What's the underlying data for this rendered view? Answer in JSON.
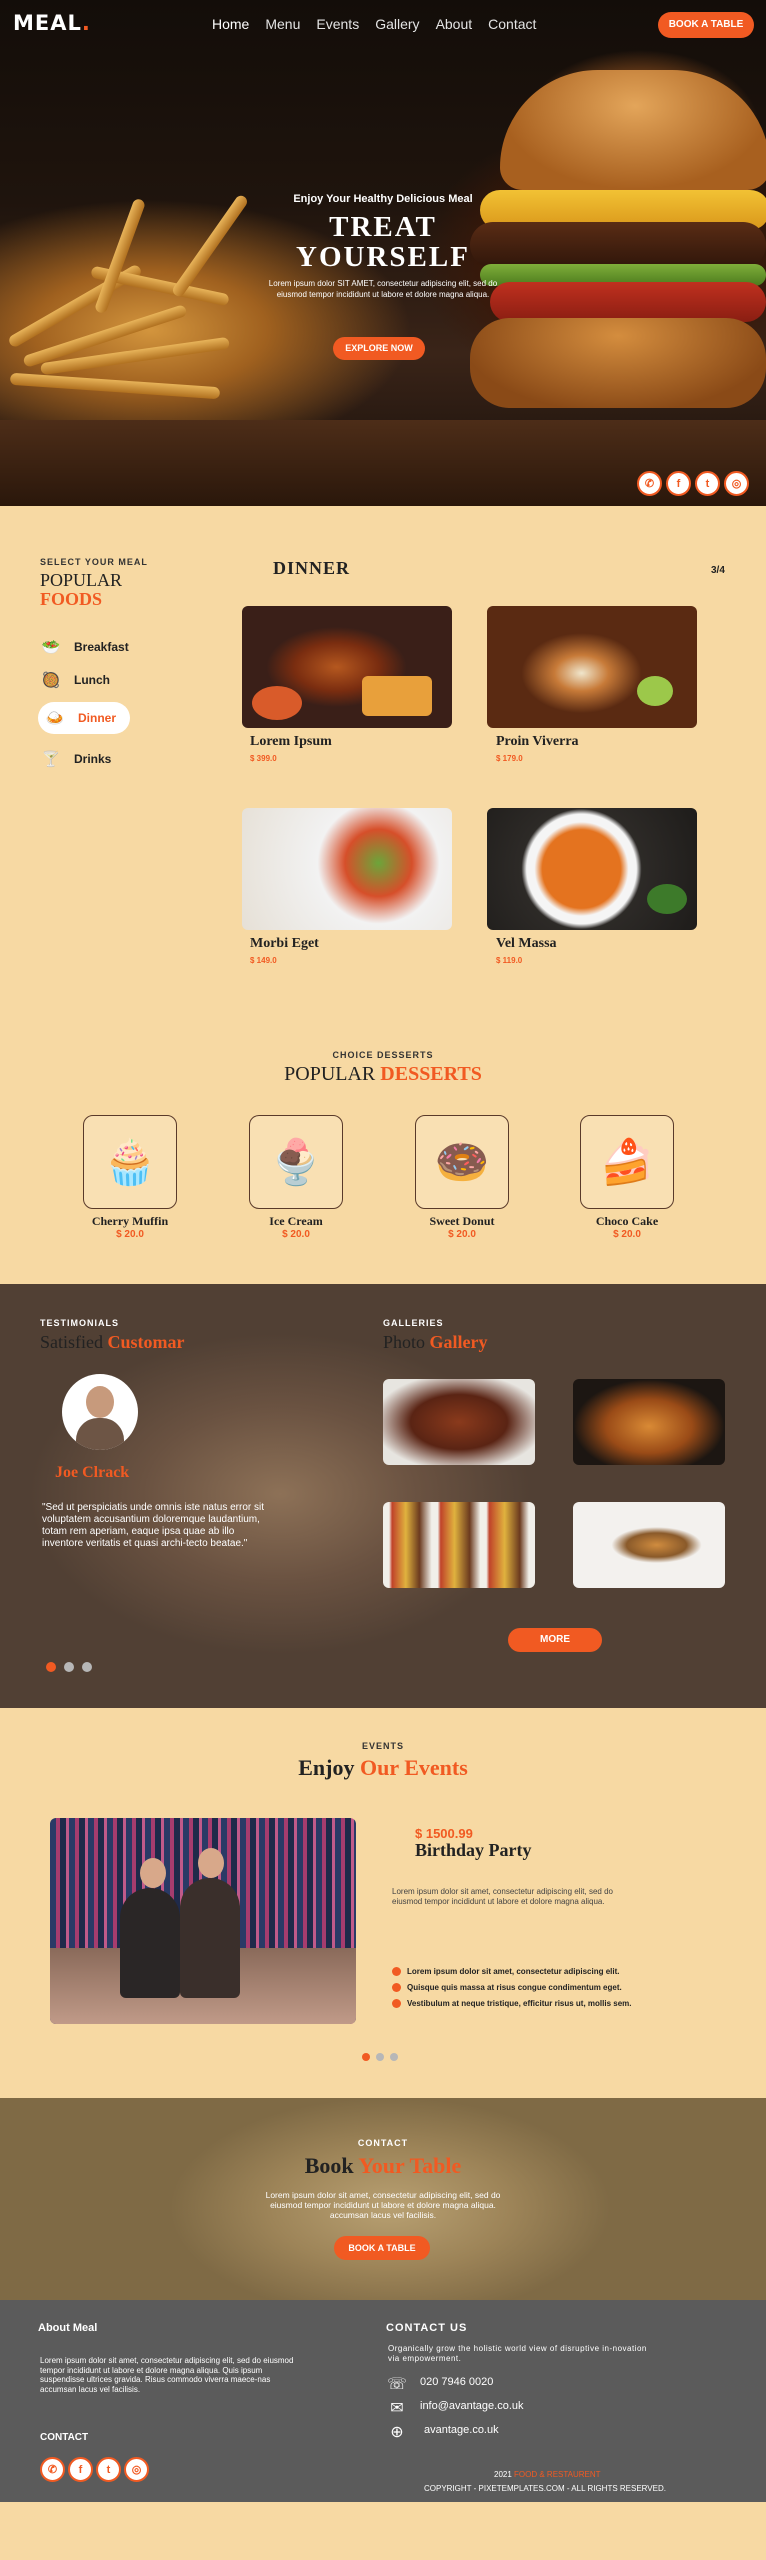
{
  "nav": {
    "logo": "MEAL",
    "links": [
      "Home",
      "Menu",
      "Events",
      "Gallery",
      "About",
      "Contact"
    ],
    "cta": "BOOK A TABLE"
  },
  "hero": {
    "subtitle": "Enjoy Your Healthy Delicious Meal",
    "title_line1": "TREAT",
    "title_line2": "YOURSELF",
    "text": "Lorem ipsum dolor SIT AMET, consectetur adipiscing elit, sed do eiusmod tempor incididunt ut labore et dolore magna aliqua.",
    "button": "EXPLORE NOW",
    "socials": [
      "whatsapp-icon",
      "facebook-icon",
      "twitter-icon",
      "instagram-icon"
    ]
  },
  "foods": {
    "label": "SELECT YOUR MEAL",
    "title1": "POPULAR",
    "title2": "FOODS",
    "categories": [
      "Breakfast",
      "Lunch",
      "Dinner",
      "Drinks"
    ],
    "active": "Dinner",
    "heading": "DINNER",
    "pager": "3/4",
    "items": [
      {
        "name": "Lorem Ipsum",
        "price": "$ 399.0"
      },
      {
        "name": "Proin Viverra",
        "price": "$ 179.0"
      },
      {
        "name": "Morbi Eget",
        "price": "$ 149.0"
      },
      {
        "name": "Vel Massa",
        "price": "$ 119.0"
      }
    ]
  },
  "desserts": {
    "label": "CHOICE DESSERTS",
    "title1": "POPULAR",
    "title2": "DESSERTS",
    "items": [
      {
        "name": "Cherry Muffin",
        "price": "$ 20.0",
        "icon": "cupcake-icon"
      },
      {
        "name": "Ice Cream",
        "price": "$ 20.0",
        "icon": "ice-cream-icon"
      },
      {
        "name": "Sweet Donut",
        "price": "$ 20.0",
        "icon": "donut-icon"
      },
      {
        "name": "Choco Cake",
        "price": "$ 20.0",
        "icon": "cake-icon"
      }
    ]
  },
  "testimonials": {
    "label": "TESTIMONIALS",
    "title1": "Satisfied",
    "title2": "Customar",
    "name": "Joe Clrack",
    "quote": "\"Sed ut perspiciatis unde omnis iste natus error sit voluptatem accusantium doloremque laudantium, totam rem aperiam, eaque ipsa quae ab illo inventore veritatis et quasi archi-tecto beatae.\""
  },
  "gallery": {
    "label": "GALLERIES",
    "title1": "Photo",
    "title2": "Gallery",
    "button": "MORE"
  },
  "events": {
    "label": "EVENTS",
    "title1": "Enjoy",
    "title2": "Our Events",
    "price": "$ 1500.99",
    "name": "Birthday Party",
    "text": "Lorem ipsum dolor sit amet, consectetur adipiscing elit, sed do eiusmod tempor incididunt ut labore et dolore magna aliqua.",
    "bullets": [
      "Lorem ipsum dolor sit amet, consectetur adipiscing elit.",
      "Quisque quis massa at risus congue condimentum eget.",
      "Vestibulum at neque tristique, efficitur risus ut, mollis sem."
    ]
  },
  "contact": {
    "label": "CONTACT",
    "title1": "Book",
    "title2": "Your Table",
    "text": "Lorem ipsum dolor sit amet, consectetur adipiscing elit, sed do eiusmod tempor incididunt ut labore et dolore magna aliqua. accumsan lacus vel facilisis.",
    "button": "BOOK A TABLE"
  },
  "footer": {
    "about_title": "About Meal",
    "about_text": "Lorem ipsum dolor sit amet, consectetur adipiscing elit, sed do eiusmod tempor incididunt ut labore et dolore magna aliqua. Quis ipsum suspendisse ultrices gravida. Risus commodo viverra maece-nas accumsan lacus vel facilisis.",
    "contact_label": "CONTACT",
    "contact_us": "CONTACT US",
    "contact_text": "Organically grow the holistic world view of disruptive in-novation via empowerment.",
    "phone": "020 7946 0020",
    "email": "info@avantage.co.uk",
    "web": "avantage.co.uk",
    "year": "2021",
    "brand": "FOOD & RESTAURENT",
    "copyright": "COPYRIGHT - PIXETEMPLATES.COM - ALL RIGHTS RESERVED."
  }
}
